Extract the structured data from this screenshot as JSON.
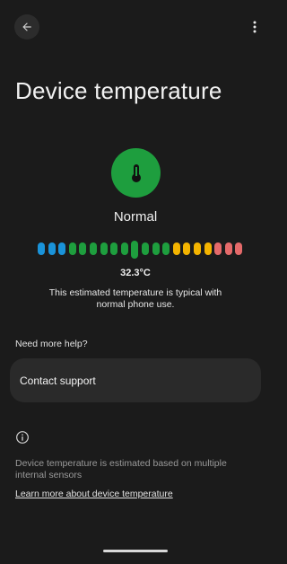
{
  "header": {
    "back_icon": "arrow-back-icon",
    "more_icon": "more-vert-icon",
    "title": "Device temperature"
  },
  "status": {
    "icon": "thermometer-icon",
    "color": "#1e9e3e",
    "label": "Normal",
    "reading": "32.3°C",
    "description": "This estimated temperature is typical with normal phone use."
  },
  "scale": {
    "segment_colors": [
      "#1a93d9",
      "#1a93d9",
      "#1a93d9",
      "#1e9e3e",
      "#1e9e3e",
      "#1e9e3e",
      "#1e9e3e",
      "#1e9e3e",
      "#1e9e3e",
      "#1e9e3e",
      "#1e9e3e",
      "#1e9e3e",
      "#1e9e3e",
      "#f4b400",
      "#f4b400",
      "#f4b400",
      "#f4b400",
      "#e56a6a",
      "#e56a6a",
      "#e56a6a"
    ],
    "active_index": 9
  },
  "help": {
    "heading": "Need more help?",
    "contact_label": "Contact support"
  },
  "footer": {
    "info_icon": "info-icon",
    "note": "Device temperature is estimated based on multiple internal sensors",
    "link": "Learn more about device temperature"
  }
}
